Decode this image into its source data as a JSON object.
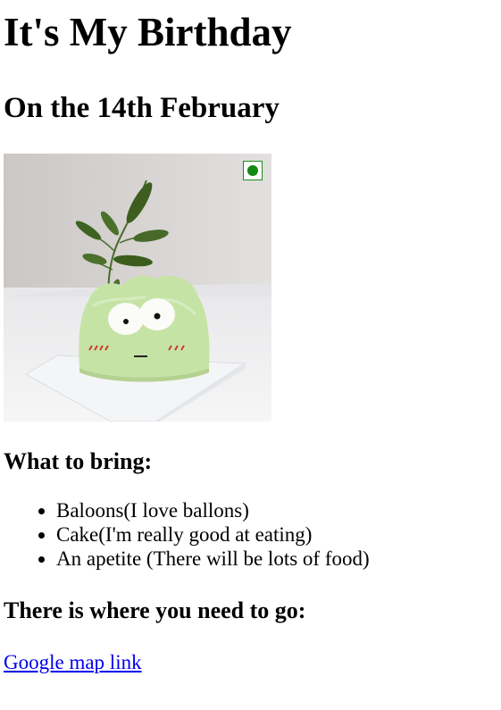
{
  "heading": {
    "title": "It's My Birthday",
    "subtitle": "On the 14th February"
  },
  "bring": {
    "title": "What to bring:",
    "items": [
      "Baloons(I love ballons)",
      "Cake(I'm really good at eating)",
      "An apetite (There will be lots of food)"
    ]
  },
  "location": {
    "title": "There is where you need to go:",
    "link_label": "Google map link"
  },
  "colors": {
    "link": "#0000ee",
    "cake": "#c6e3a6",
    "badge": "#138a13"
  },
  "icons": {
    "badge": "veg-indicator-icon"
  }
}
